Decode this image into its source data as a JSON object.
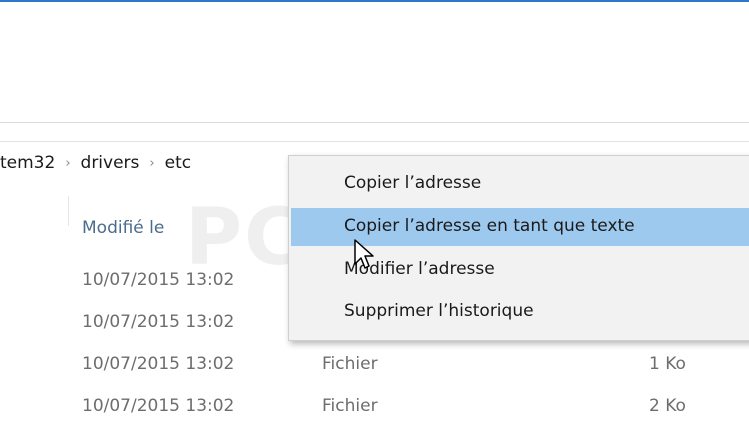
{
  "breadcrumb": {
    "items": [
      "tem32",
      "drivers",
      "etc"
    ],
    "separator": "›"
  },
  "columns": {
    "modified_label": "Modifié le"
  },
  "files": [
    {
      "date": "10/07/2015 13:02",
      "type": "",
      "size": ""
    },
    {
      "date": "10/07/2015 13:02",
      "type": "",
      "size": ""
    },
    {
      "date": "10/07/2015 13:02",
      "type": "Fichier",
      "size": "1 Ko"
    },
    {
      "date": "10/07/2015 13:02",
      "type": "Fichier",
      "size": "2 Ko"
    }
  ],
  "context_menu": {
    "items": [
      {
        "label": "Copier l’adresse"
      },
      {
        "label": "Copier l’adresse en tant que texte",
        "highlighted": true
      },
      {
        "label": "Modifier l’adresse"
      },
      {
        "label": "Supprimer l’historique"
      }
    ]
  },
  "watermark": {
    "text": "PC ASTUCES"
  },
  "colors": {
    "accent": "#2b78c8",
    "menu_highlight": "#9ec9ef",
    "header_text": "#4a6d8c"
  },
  "icons": {
    "cursor": "arrow-pointer-icon"
  }
}
